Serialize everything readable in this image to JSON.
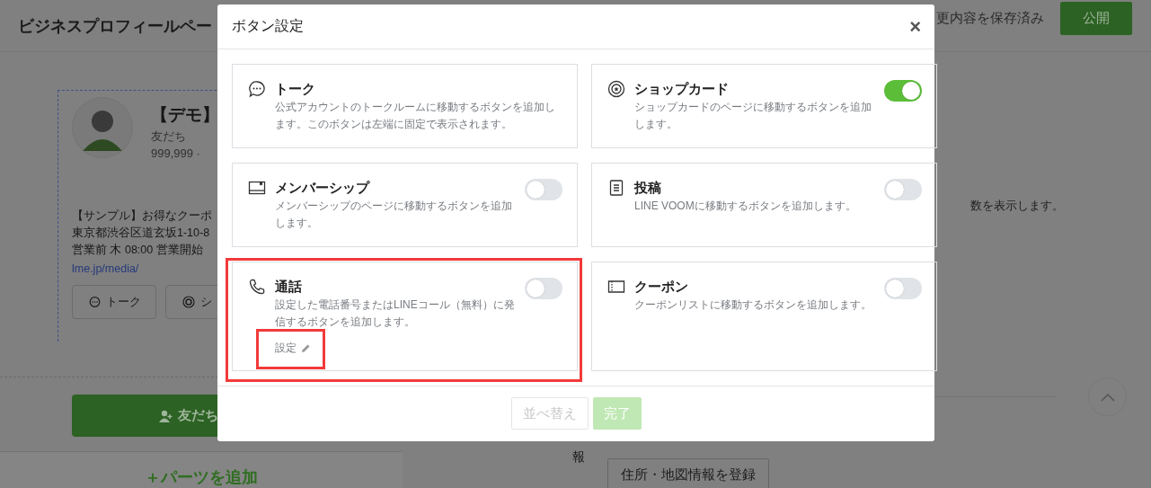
{
  "page": {
    "title": "ビジネスプロフィールペー",
    "save_status": "更内容を保存済み",
    "publish_button": "公開",
    "preview": {
      "name": "【デモ】",
      "friends_label": "友だち",
      "friends_count": "999,999 ·",
      "lines": [
        "【サンプル】お得なクーポ",
        "東京都渋谷区道玄坂1-10-8",
        "営業前 木 08:00 営業開始"
      ],
      "link": "lme.jp/media/",
      "buttons": [
        "トーク",
        "シ"
      ],
      "add_friend_button": "友だち"
    },
    "add_parts": "＋パーツを追加",
    "right": {
      "description_tail": "数を表示します。",
      "address_label_tail": "報",
      "address_button": "住所・地図情報を登録"
    }
  },
  "dialog": {
    "title": "ボタン設定",
    "close": "×",
    "items": [
      {
        "title": "トーク",
        "description": "公式アカウントのトークルームに移動するボタンを追加します。このボタンは左端に固定で表示されます。",
        "highlighted": false
      },
      {
        "title": "ショップカード",
        "description": "ショップカードのページに移動するボタンを追加します。",
        "on": true,
        "highlighted": false
      },
      {
        "title": "メンバーシップ",
        "description": "メンバーシップのページに移動するボタンを追加します。",
        "on": false,
        "highlighted": false
      },
      {
        "title": "投稿",
        "description": "LINE VOOMに移動するボタンを追加します。",
        "on": false,
        "highlighted": false
      },
      {
        "title": "通話",
        "description": "設定した電話番号またはLINEコール（無料）に発信するボタンを追加します。",
        "on": false,
        "highlighted": true,
        "link": {
          "label": "設定",
          "highlighted": true
        }
      },
      {
        "title": "クーポン",
        "description": "クーポンリストに移動するボタンを追加します。",
        "on": false,
        "highlighted": false
      }
    ],
    "buttons": [
      {
        "label": "並べ替え",
        "kind": "secondary",
        "disabled": true
      },
      {
        "label": "完了",
        "kind": "primary",
        "disabled": true
      }
    ]
  }
}
